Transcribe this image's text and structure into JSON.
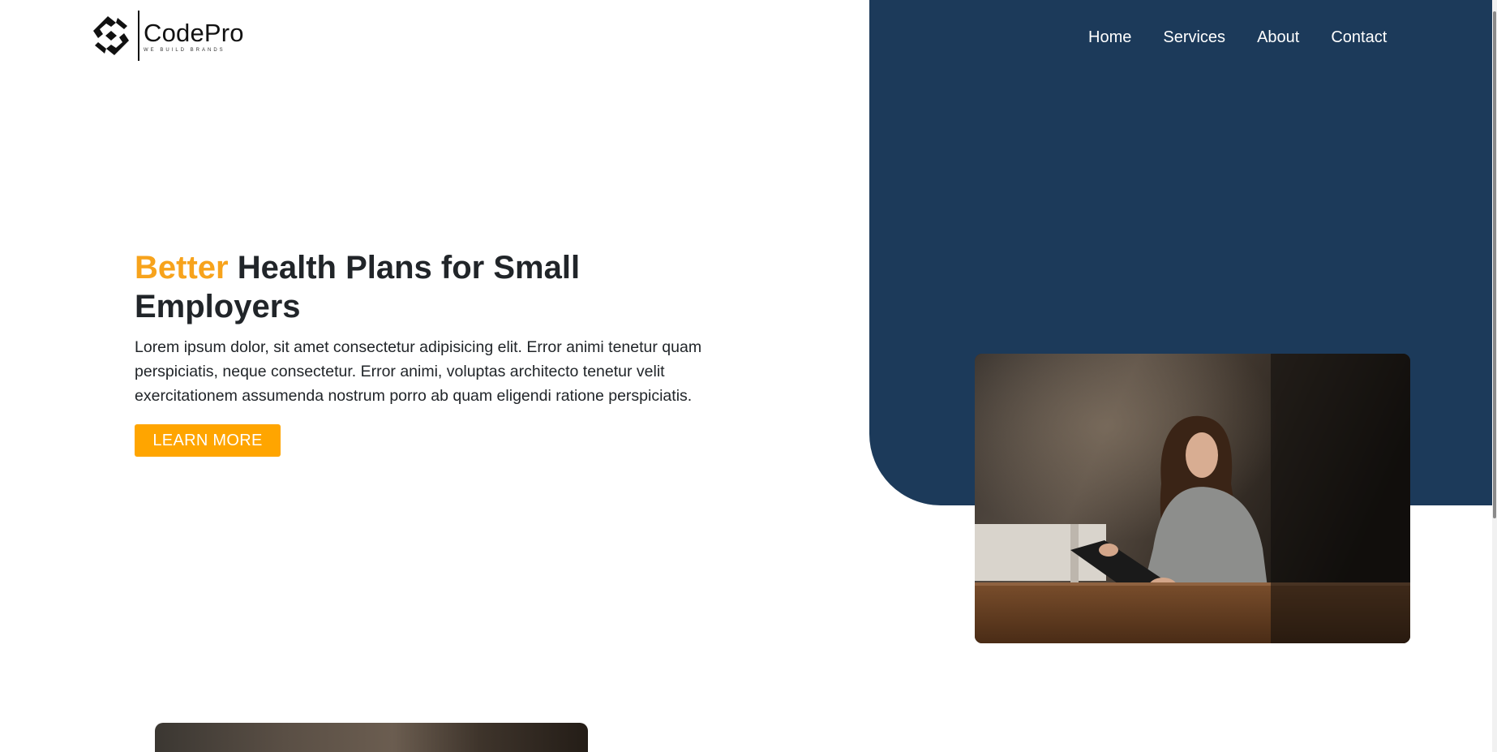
{
  "header": {
    "logo_name": "CodePro",
    "logo_tagline": "WE BUILD BRANDS",
    "nav": [
      "Home",
      "Services",
      "About",
      "Contact"
    ]
  },
  "hero": {
    "title_accent": "Better",
    "title_rest": " Health Plans for Small Employers",
    "description": "Lorem ipsum dolor, sit amet consectetur adipisicing elit. Error animi tenetur quam perspiciatis, neque consectetur. Error animi, voluptas architecto tenetur velit exercitationem assumenda nostrum porro ab quam eligendi ratione perspiciatis.",
    "cta_label": "LEARN MORE"
  },
  "colors": {
    "accent": "#f7a31c",
    "button": "#ffa500",
    "panel": "#1c3a5a"
  },
  "icons": {
    "logo": "codepro-logo-icon"
  }
}
